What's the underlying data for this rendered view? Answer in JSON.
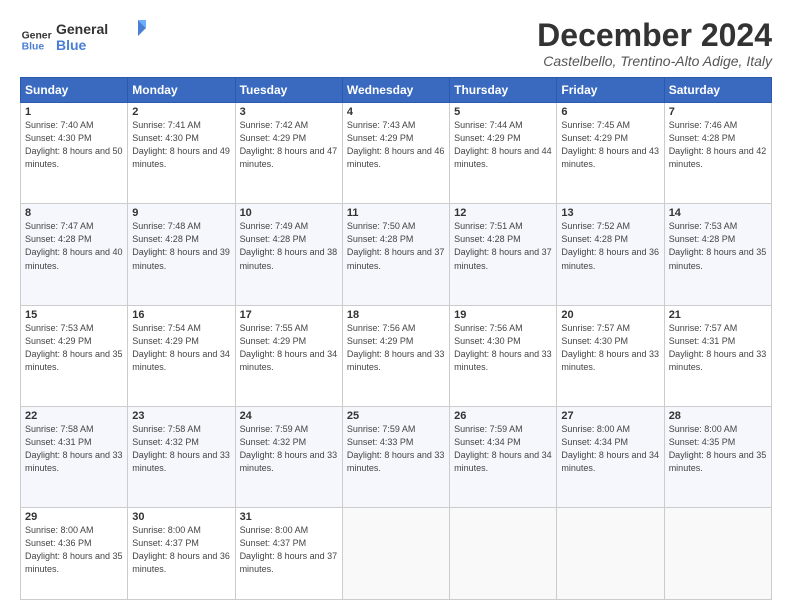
{
  "logo": {
    "line1": "General",
    "line2": "Blue"
  },
  "title": "December 2024",
  "location": "Castelbello, Trentino-Alto Adige, Italy",
  "days_header": [
    "Sunday",
    "Monday",
    "Tuesday",
    "Wednesday",
    "Thursday",
    "Friday",
    "Saturday"
  ],
  "weeks": [
    [
      {
        "day": "1",
        "sunrise": "7:40 AM",
        "sunset": "4:30 PM",
        "daylight": "8 hours and 50 minutes."
      },
      {
        "day": "2",
        "sunrise": "7:41 AM",
        "sunset": "4:30 PM",
        "daylight": "8 hours and 49 minutes."
      },
      {
        "day": "3",
        "sunrise": "7:42 AM",
        "sunset": "4:29 PM",
        "daylight": "8 hours and 47 minutes."
      },
      {
        "day": "4",
        "sunrise": "7:43 AM",
        "sunset": "4:29 PM",
        "daylight": "8 hours and 46 minutes."
      },
      {
        "day": "5",
        "sunrise": "7:44 AM",
        "sunset": "4:29 PM",
        "daylight": "8 hours and 44 minutes."
      },
      {
        "day": "6",
        "sunrise": "7:45 AM",
        "sunset": "4:29 PM",
        "daylight": "8 hours and 43 minutes."
      },
      {
        "day": "7",
        "sunrise": "7:46 AM",
        "sunset": "4:28 PM",
        "daylight": "8 hours and 42 minutes."
      }
    ],
    [
      {
        "day": "8",
        "sunrise": "7:47 AM",
        "sunset": "4:28 PM",
        "daylight": "8 hours and 40 minutes."
      },
      {
        "day": "9",
        "sunrise": "7:48 AM",
        "sunset": "4:28 PM",
        "daylight": "8 hours and 39 minutes."
      },
      {
        "day": "10",
        "sunrise": "7:49 AM",
        "sunset": "4:28 PM",
        "daylight": "8 hours and 38 minutes."
      },
      {
        "day": "11",
        "sunrise": "7:50 AM",
        "sunset": "4:28 PM",
        "daylight": "8 hours and 37 minutes."
      },
      {
        "day": "12",
        "sunrise": "7:51 AM",
        "sunset": "4:28 PM",
        "daylight": "8 hours and 37 minutes."
      },
      {
        "day": "13",
        "sunrise": "7:52 AM",
        "sunset": "4:28 PM",
        "daylight": "8 hours and 36 minutes."
      },
      {
        "day": "14",
        "sunrise": "7:53 AM",
        "sunset": "4:28 PM",
        "daylight": "8 hours and 35 minutes."
      }
    ],
    [
      {
        "day": "15",
        "sunrise": "7:53 AM",
        "sunset": "4:29 PM",
        "daylight": "8 hours and 35 minutes."
      },
      {
        "day": "16",
        "sunrise": "7:54 AM",
        "sunset": "4:29 PM",
        "daylight": "8 hours and 34 minutes."
      },
      {
        "day": "17",
        "sunrise": "7:55 AM",
        "sunset": "4:29 PM",
        "daylight": "8 hours and 34 minutes."
      },
      {
        "day": "18",
        "sunrise": "7:56 AM",
        "sunset": "4:29 PM",
        "daylight": "8 hours and 33 minutes."
      },
      {
        "day": "19",
        "sunrise": "7:56 AM",
        "sunset": "4:30 PM",
        "daylight": "8 hours and 33 minutes."
      },
      {
        "day": "20",
        "sunrise": "7:57 AM",
        "sunset": "4:30 PM",
        "daylight": "8 hours and 33 minutes."
      },
      {
        "day": "21",
        "sunrise": "7:57 AM",
        "sunset": "4:31 PM",
        "daylight": "8 hours and 33 minutes."
      }
    ],
    [
      {
        "day": "22",
        "sunrise": "7:58 AM",
        "sunset": "4:31 PM",
        "daylight": "8 hours and 33 minutes."
      },
      {
        "day": "23",
        "sunrise": "7:58 AM",
        "sunset": "4:32 PM",
        "daylight": "8 hours and 33 minutes."
      },
      {
        "day": "24",
        "sunrise": "7:59 AM",
        "sunset": "4:32 PM",
        "daylight": "8 hours and 33 minutes."
      },
      {
        "day": "25",
        "sunrise": "7:59 AM",
        "sunset": "4:33 PM",
        "daylight": "8 hours and 33 minutes."
      },
      {
        "day": "26",
        "sunrise": "7:59 AM",
        "sunset": "4:34 PM",
        "daylight": "8 hours and 34 minutes."
      },
      {
        "day": "27",
        "sunrise": "8:00 AM",
        "sunset": "4:34 PM",
        "daylight": "8 hours and 34 minutes."
      },
      {
        "day": "28",
        "sunrise": "8:00 AM",
        "sunset": "4:35 PM",
        "daylight": "8 hours and 35 minutes."
      }
    ],
    [
      {
        "day": "29",
        "sunrise": "8:00 AM",
        "sunset": "4:36 PM",
        "daylight": "8 hours and 35 minutes."
      },
      {
        "day": "30",
        "sunrise": "8:00 AM",
        "sunset": "4:37 PM",
        "daylight": "8 hours and 36 minutes."
      },
      {
        "day": "31",
        "sunrise": "8:00 AM",
        "sunset": "4:37 PM",
        "daylight": "8 hours and 37 minutes."
      },
      null,
      null,
      null,
      null
    ]
  ]
}
